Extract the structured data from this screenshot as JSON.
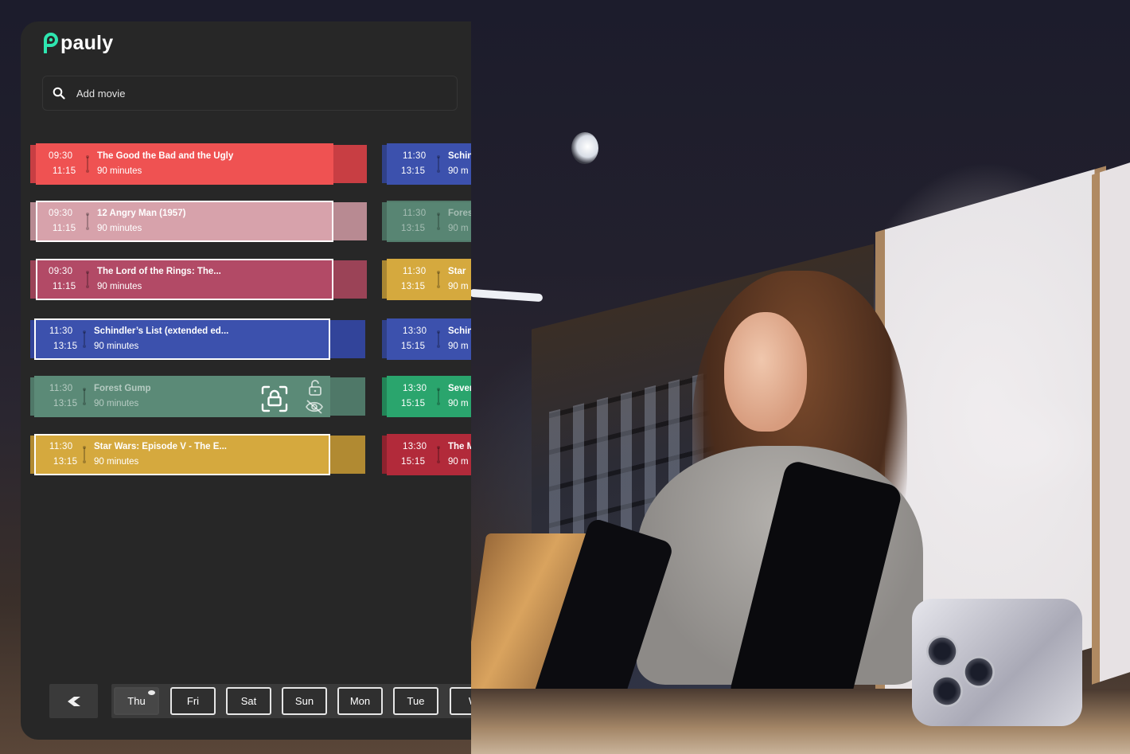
{
  "app": {
    "brand": "pauly",
    "accent": "#2ee6b0"
  },
  "search": {
    "placeholder": "Add movie",
    "icon": "search-icon"
  },
  "columns": [
    {
      "cards": [
        {
          "start": "09:30",
          "end": "11:15",
          "title": "The Good the Bad and the Ugly",
          "duration": "90 minutes",
          "color": "#ef5252",
          "back": "#c83e43",
          "bordered": false,
          "faded": false
        },
        {
          "start": "09:30",
          "end": "11:15",
          "title": "12 Angry Man (1957)",
          "duration": "90 minutes",
          "color": "#d7a2ab",
          "back": "#b88a92",
          "bordered": true,
          "faded": false
        },
        {
          "start": "09:30",
          "end": "11:15",
          "title": "The Lord of the Rings: The...",
          "duration": "90 minutes",
          "color": "#b24a66",
          "back": "#9b4357",
          "bordered": true,
          "faded": false
        },
        {
          "start": "11:30",
          "end": "13:15",
          "title": "Schindler’s List (extended ed...",
          "duration": "90 minutes",
          "color": "#3c51ad",
          "back": "#32449a",
          "bordered": true,
          "faded": false
        },
        {
          "start": "11:30",
          "end": "13:15",
          "title": "Forest Gump",
          "duration": "90 minutes",
          "color": "#5b8a77",
          "back": "#4f7868",
          "bordered": false,
          "faded": true
        },
        {
          "start": "11:30",
          "end": "13:15",
          "title": "Star Wars: Episode V - The E...",
          "duration": "90 minutes",
          "color": "#d5a93e",
          "back": "#b18a32",
          "bordered": true,
          "faded": false
        }
      ]
    },
    {
      "cards": [
        {
          "start": "11:30",
          "end": "13:15",
          "title": "Schin",
          "duration": "90 m",
          "color": "#3c51ad"
        },
        {
          "start": "11:30",
          "end": "13:15",
          "title": "Fores",
          "duration": "90 m",
          "color": "#5b8a77"
        },
        {
          "start": "11:30",
          "end": "13:15",
          "title": "Star",
          "duration": "90 m",
          "color": "#d5a93e"
        },
        {
          "start": "13:30",
          "end": "15:15",
          "title": "Schin",
          "duration": "90 m",
          "color": "#3c51ad"
        },
        {
          "start": "13:30",
          "end": "15:15",
          "title": "Sever",
          "duration": "90 m",
          "color": "#2aa56d"
        },
        {
          "start": "13:30",
          "end": "15:15",
          "title": "The M",
          "duration": "90 m",
          "color": "#b22a3a"
        }
      ]
    }
  ],
  "card_actions": {
    "lock_focus_icon": "lock-focus-icon",
    "unlock_icon": "unlock-icon",
    "hide_icon": "eye-off-icon"
  },
  "days": [
    "Thu",
    "Fri",
    "Sat",
    "Sun",
    "Mon",
    "Tue",
    "W"
  ],
  "active_day": "Thu",
  "back_icon": "chevron-left-icon"
}
